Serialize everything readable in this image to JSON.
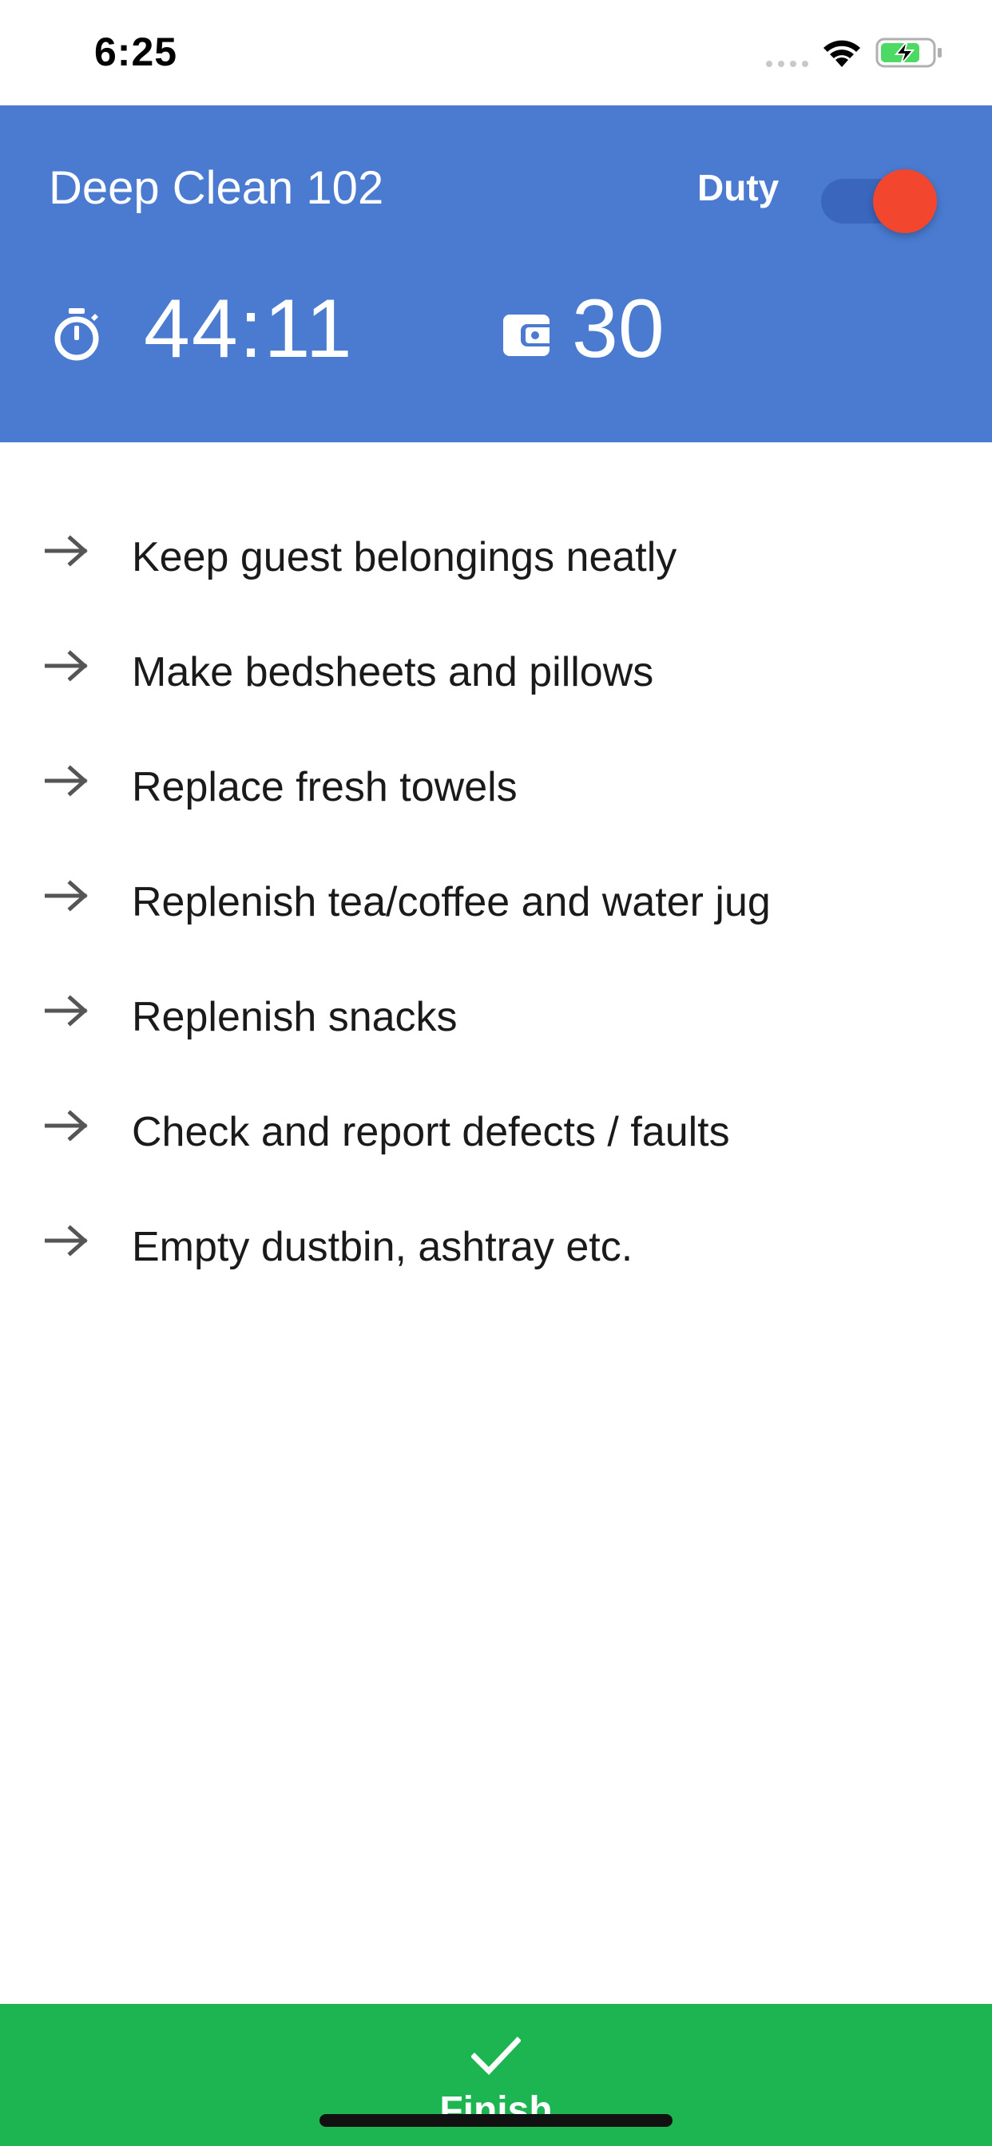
{
  "status_bar": {
    "time": "6:25",
    "battery_color": "#4cd964",
    "icons": [
      "signal-icon",
      "wifi-icon",
      "battery-charging-icon"
    ]
  },
  "header": {
    "title": "Deep Clean 102",
    "duty_label": "Duty",
    "duty_on": true,
    "timer_value": "44:11",
    "count_value": "30",
    "background_color": "#4a7bd1",
    "toggle_thumb_color": "#f2462e",
    "icons": [
      "timer-icon",
      "wallet-icon"
    ]
  },
  "tasks": [
    {
      "label": "Keep guest belongings neatly"
    },
    {
      "label": "Make bedsheets and pillows"
    },
    {
      "label": "Replace fresh towels"
    },
    {
      "label": "Replenish tea/coffee and water jug"
    },
    {
      "label": "Replenish snacks"
    },
    {
      "label": "Check and report defects / faults"
    },
    {
      "label": "Empty dustbin, ashtray etc."
    }
  ],
  "finish": {
    "label": "Finish",
    "icon": "check-icon",
    "background_color": "#1db551"
  }
}
